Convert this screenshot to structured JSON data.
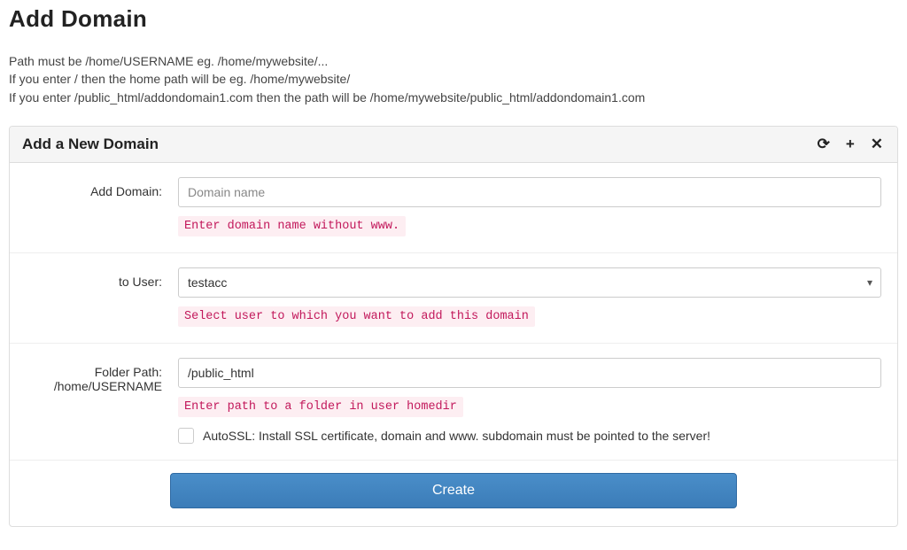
{
  "page": {
    "title": "Add Domain",
    "help_line1": "Path must be /home/USERNAME eg. /home/mywebsite/...",
    "help_line2": "If you enter / then the home path will be eg. /home/mywebsite/",
    "help_line3": "If you enter /public_html/addondomain1.com then the path will be /home/mywebsite/public_html/addondomain1.com"
  },
  "panel": {
    "title": "Add a New Domain",
    "refresh_icon": "⟳",
    "add_icon": "+",
    "close_icon": "✕"
  },
  "form": {
    "domain": {
      "label": "Add Domain:",
      "placeholder": "Domain name",
      "value": "",
      "hint": "Enter domain name without www."
    },
    "user": {
      "label": "to User:",
      "selected": "testacc",
      "hint": "Select user to which you want to add this domain"
    },
    "folder": {
      "label_line1": "Folder Path:",
      "label_line2": "/home/USERNAME",
      "value": "/public_html",
      "hint": "Enter path to a folder in user homedir",
      "autossl_label": "AutoSSL: Install SSL certificate, domain and www. subdomain must be pointed to the server!",
      "autossl_checked": false
    },
    "submit_label": "Create"
  }
}
